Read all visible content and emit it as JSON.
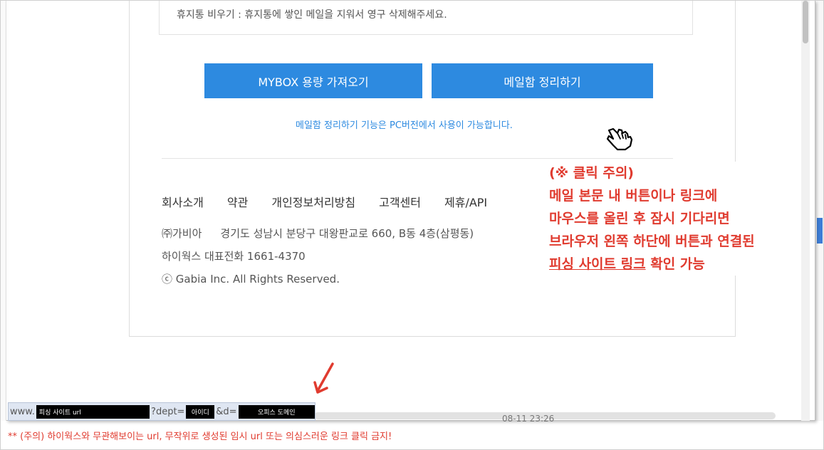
{
  "notice": {
    "text": "휴지통 비우기 : 휴지통에 쌓인 메일을 지워서 영구 삭제해주세요."
  },
  "buttons": {
    "mybox": "MYBOX 용량 가져오기",
    "clean": "메일함 정리하기"
  },
  "info": "메일함 정리하기 기능은 PC버전에서 사용이 가능합니다.",
  "footer": {
    "links": [
      "회사소개",
      "약관",
      "개인정보처리방침",
      "고객센터",
      "제휴/API"
    ],
    "company": "㈜가비아",
    "address": "경기도 성남시 분당구 대왕판교로 660, B동 4층(삼평동)",
    "tel": "하이웍스 대표전화 1661-4370",
    "copyright": "ⓒ Gabia Inc. All Rights Reserved."
  },
  "warning": {
    "title": "(※ 클릭 주의)",
    "line1": "메일 본문 내 버튼이나 링크에",
    "line2": "마우스를 올린 후 잠시 기다리면",
    "line3": "브라우저 왼쪽 하단에 버튼과 연결된",
    "line4_underlined": "피싱 사이트 링크",
    "line4_rest": " 확인 가능"
  },
  "statusbar": {
    "prefix": "www.",
    "site_label": "피싱 사이트 url",
    "dept_param": "?dept=",
    "id_label": "아이디",
    "d_param": "&d=",
    "domain_label": "오피스 도메인"
  },
  "partial_date": "08-11 23:26",
  "bottom_note": "** (주의) 하이웍스와 무관해보이는 url, 무작위로 생성된 임시 url 또는 의심스러운 링크 클릭 금지!",
  "colors": {
    "accent_blue": "#2d8ae0",
    "warning_red": "#e03b2f"
  },
  "icons": [
    "pointer-hand-icon",
    "red-arrow-icon"
  ]
}
